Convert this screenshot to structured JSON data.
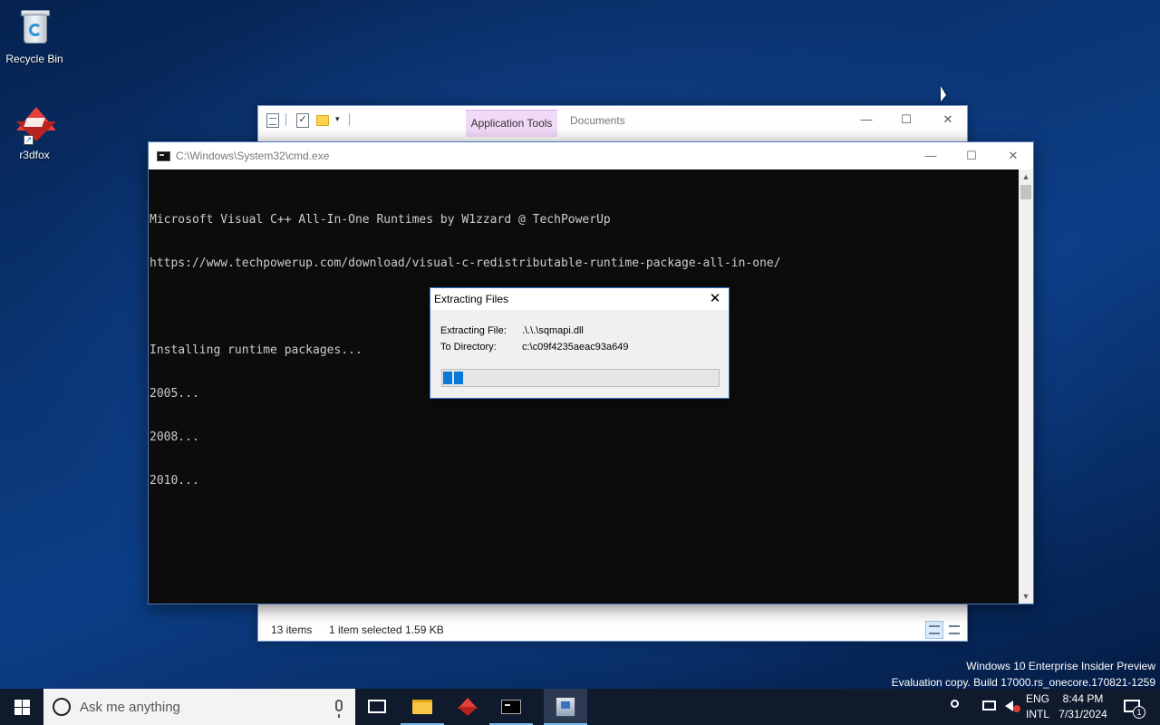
{
  "desktop": {
    "icons": [
      {
        "label": "Recycle Bin",
        "icon": "recycle-bin-icon"
      },
      {
        "label": "r3dfox",
        "icon": "r3dfox-icon"
      }
    ]
  },
  "explorer": {
    "contextual_tab": "Application Tools",
    "title": "Documents",
    "status": {
      "count": "13 items",
      "selection": "1 item selected  1.59 KB"
    },
    "controls": {
      "minimize": "—",
      "maximize": "☐",
      "close": "✕"
    }
  },
  "cmd": {
    "title": "C:\\Windows\\System32\\cmd.exe",
    "controls": {
      "minimize": "—",
      "maximize": "☐",
      "close": "✕"
    },
    "lines": [
      "Microsoft Visual C++ All-In-One Runtimes by W1zzard @ TechPowerUp",
      "https://www.techpowerup.com/download/visual-c-redistributable-runtime-package-all-in-one/",
      "",
      "Installing runtime packages...",
      "2005...",
      "2008...",
      "2010..."
    ]
  },
  "extract_dialog": {
    "title": "Extracting Files",
    "close": "✕",
    "file_label": "Extracting File:",
    "file_value": ".\\.\\.\\sqmapi.dll",
    "dir_label": "To Directory:",
    "dir_value": "c:\\c09f4235aeac93a649",
    "progress_blocks": 2
  },
  "watermark": {
    "line1": "Windows 10 Enterprise Insider Preview",
    "line2": "Evaluation copy. Build 17000.rs_onecore.170821-1259"
  },
  "taskbar": {
    "search_placeholder": "Ask me anything",
    "lang_line1": "ENG",
    "lang_line2": "INTL",
    "time": "8:44 PM",
    "date": "7/31/2024",
    "notification_count": "1"
  },
  "colors": {
    "accent": "#0a78d7",
    "console_bg": "#0c0c0c",
    "console_text": "#cccccc",
    "taskbar_bg": "#0f1a2c",
    "app_tools_bg": "#f1d9f7"
  }
}
